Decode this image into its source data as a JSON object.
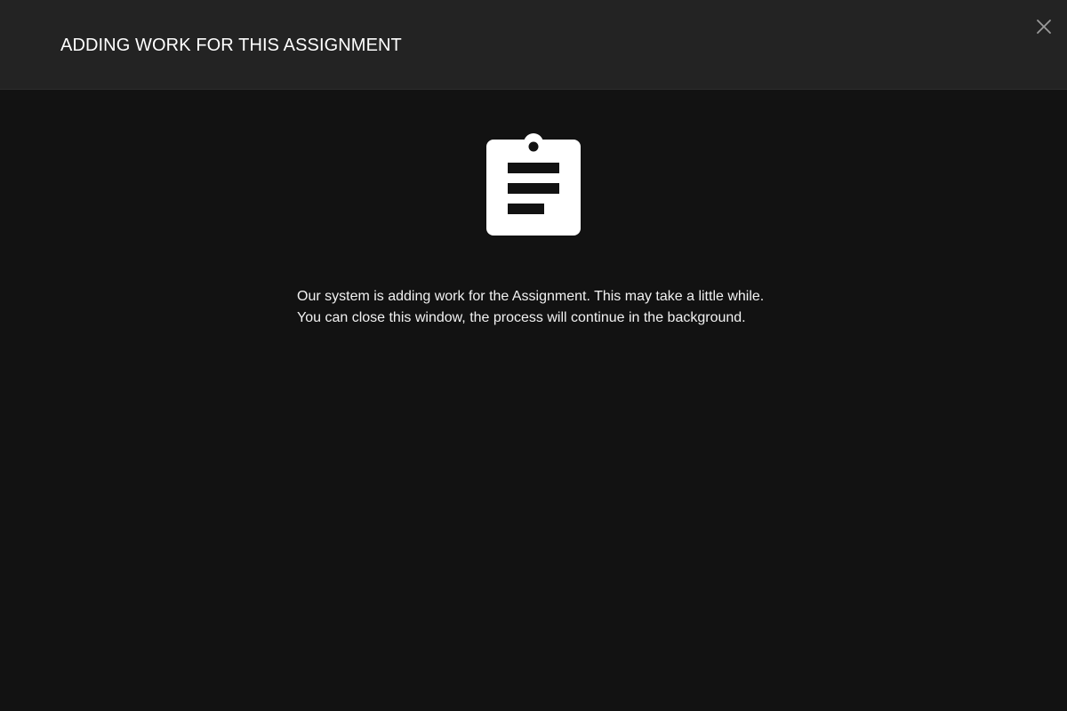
{
  "dialog": {
    "title": "ADDING WORK FOR THIS ASSIGNMENT",
    "close_icon": "close-icon",
    "status_icon": "clipboard-list-icon",
    "message": {
      "line1": "Our system is adding work for the Assignment. This may take a little while.",
      "line2": "You can close this window, the process will continue in the background."
    }
  },
  "colors": {
    "header_background": "#232323",
    "body_background": "#121212",
    "text": "#ffffff",
    "close_icon": "#9a9a9a"
  }
}
